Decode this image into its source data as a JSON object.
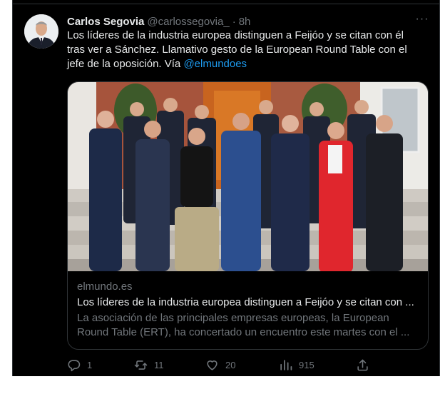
{
  "tweet": {
    "author_name": "Carlos Segovia",
    "author_handle": "@carlossegovia_",
    "time": "8h",
    "separator": "·",
    "text_line1": "Los líderes de la industria europea distinguen a Feijóo y se citan con él",
    "text_line2": "tras ver a Sánchez. Llamativo gesto de la European Round Table con el",
    "text_line3": "jefe de la oposición. Vía ",
    "mention": "@elmundoes",
    "more_glyph": "···"
  },
  "card": {
    "domain": "elmundo.es",
    "title": "Los líderes de la industria europea distinguen a Feijóo y se citan con ...",
    "description": "La asociación de las principales empresas europeas, la European Round Table (ERT), ha concertado un encuentro este martes con el ..."
  },
  "actions": {
    "replies": "1",
    "retweets": "11",
    "likes": "20",
    "views": "915"
  },
  "icons": [
    "avatar",
    "more-icon",
    "reply-icon",
    "retweet-icon",
    "like-icon",
    "views-icon",
    "share-icon"
  ],
  "colors": {
    "background": "#000000",
    "text": "#e7e9ea",
    "secondary": "#71767b",
    "link": "#1d9bf0",
    "border": "#2f3336"
  }
}
